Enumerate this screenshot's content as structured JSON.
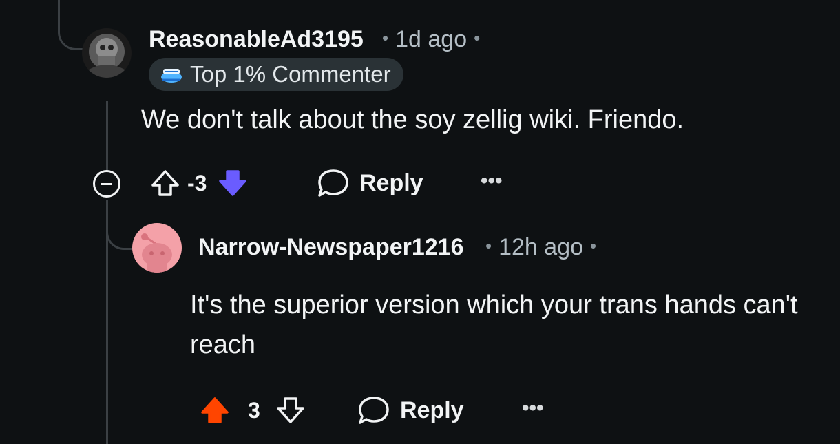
{
  "comments": [
    {
      "username": "ReasonableAd3195",
      "time": "1d ago",
      "badge": "Top 1% Commenter",
      "body": "We don't talk about the soy zellig wiki. Friendo.",
      "score": "-3",
      "vote_state": "downvoted",
      "reply_label": "Reply",
      "more_label": "•••"
    },
    {
      "username": "Narrow-Newspaper1216",
      "time": "12h ago",
      "body": "It's the superior version which your trans hands can't reach",
      "score": "3",
      "vote_state": "upvoted",
      "reply_label": "Reply",
      "more_label": "•••"
    }
  ],
  "colors": {
    "background": "#0e1113",
    "upvote": "#ff4500",
    "downvote": "#6a5cff",
    "thread_line": "#3b4044"
  }
}
